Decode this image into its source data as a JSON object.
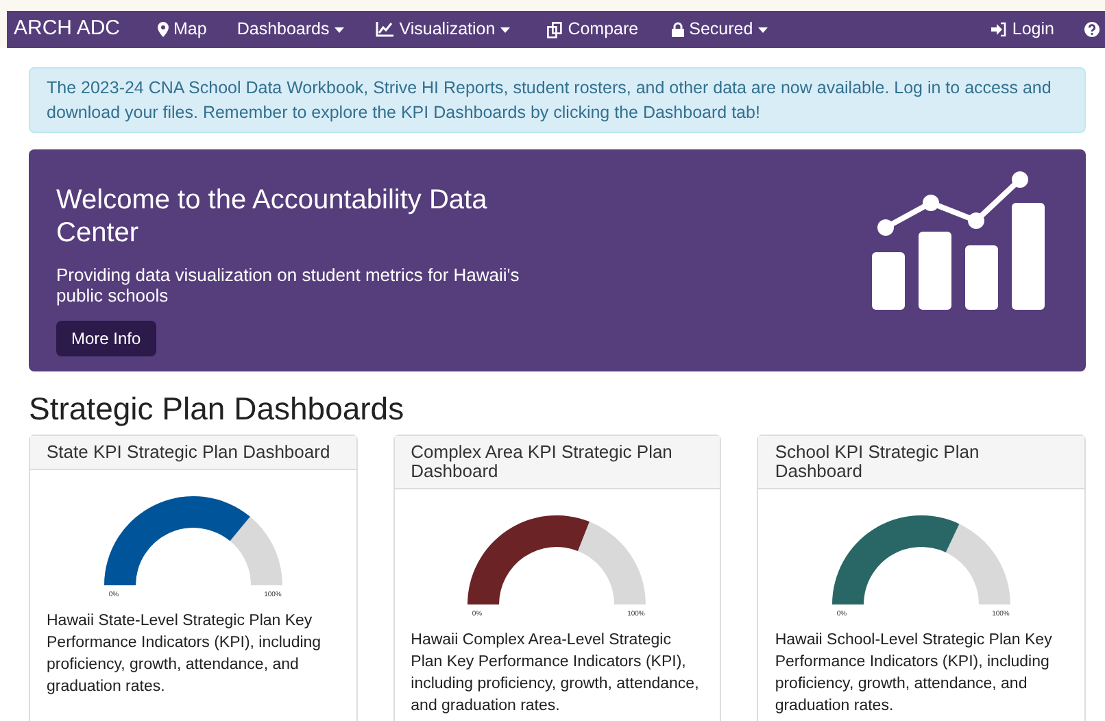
{
  "navbar": {
    "brand": "ARCH ADC",
    "items": [
      {
        "label": "Map",
        "dropdown": false
      },
      {
        "label": "Dashboards",
        "dropdown": true
      },
      {
        "label": "Visualization",
        "dropdown": true
      },
      {
        "label": "Compare",
        "dropdown": false
      },
      {
        "label": "Secured",
        "dropdown": true
      }
    ],
    "login": "Login"
  },
  "alert": "The 2023-24 CNA School Data Workbook, Strive HI Reports, student rosters, and other data are now available. Log in to access and download your files. Remember to explore the KPI Dashboards by clicking the Dashboard tab!",
  "hero": {
    "title": "Welcome to the Accountability Data Center",
    "subtitle": "Providing data visualization on student metrics for Hawaii's public schools",
    "button": "More Info"
  },
  "section_title": "Strategic Plan Dashboards",
  "cards": [
    {
      "title": "State KPI Strategic Plan Dashboard",
      "level": 0.72,
      "color": "#00559a",
      "min_label": "0%",
      "max_label": "100%",
      "description": "Hawaii State-Level Strategic Plan Key Performance Indicators (KPI), including proficiency, growth, attendance, and graduation rates."
    },
    {
      "title": "Complex Area KPI Strategic Plan Dashboard",
      "level": 0.62,
      "color": "#6b2325",
      "min_label": "0%",
      "max_label": "100%",
      "description": "Hawaii Complex Area-Level Strategic Plan Key Performance Indicators (KPI), including proficiency, growth, attendance, and graduation rates."
    },
    {
      "title": "School KPI Strategic Plan Dashboard",
      "level": 0.64,
      "color": "#296767",
      "min_label": "0%",
      "max_label": "100%",
      "description": "Hawaii School-Level Strategic Plan Key Performance Indicators (KPI), including proficiency, growth, attendance, and graduation rates."
    }
  ]
}
